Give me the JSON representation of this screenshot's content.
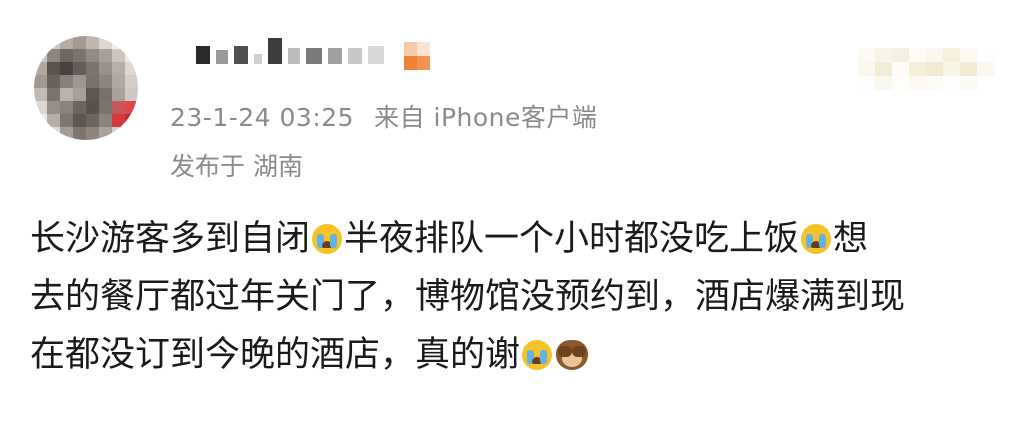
{
  "post": {
    "timestamp": "23-1-24 03:25",
    "source": "来自 iPhone客户端",
    "location": "发布于 湖南",
    "lines": [
      [
        "长沙游客多到自闭",
        "半夜排队一个小时都没吃上饭",
        "想"
      ],
      [
        "去的餐厅都过年关门了，博物馆没预约到，酒店爆满到现"
      ],
      [
        "在都没订到今晚的酒店，真的谢"
      ]
    ],
    "emojis": [
      "crying-face",
      "crying-face",
      "crying-face",
      "see-no-evil-monkey"
    ]
  },
  "colors": {
    "meta_text": "#8a8a8a",
    "body_text": "#1a1a1a",
    "accent_orange": "#f0813a"
  }
}
